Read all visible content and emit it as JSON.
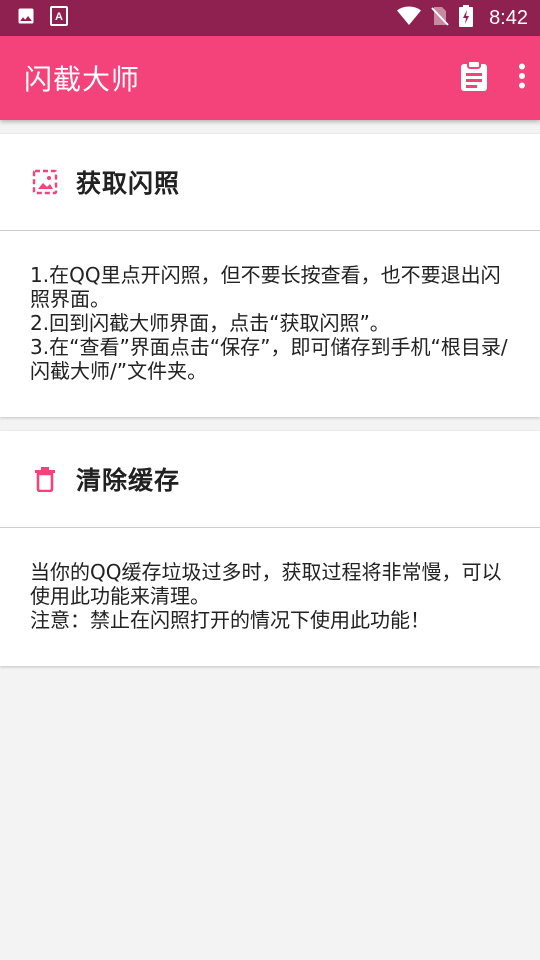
{
  "status_bar": {
    "time": "8:42",
    "left_icons": [
      "image-icon",
      "text-a-icon"
    ],
    "right_icons": [
      "wifi-icon",
      "no-sim-icon",
      "battery-charging-icon"
    ]
  },
  "app_bar": {
    "title": "闪截大师",
    "actions": [
      "clipboard-icon",
      "more-vert-icon"
    ],
    "color": "#f4437a",
    "status_color": "#8e2150"
  },
  "cards": [
    {
      "title": "获取闪照",
      "icon": "photo-icon",
      "lines": [
        "1.在QQ里点开闪照，但不要长按查看，也不要退出闪照界面。",
        "2.回到闪截大师界面，点击“获取闪照”。",
        "3.在“查看”界面点击“保存”，即可储存到手机“根目录/闪截大师/”文件夹。"
      ]
    },
    {
      "title": "清除缓存",
      "icon": "trash-icon",
      "lines": [
        "当你的QQ缓存垃圾过多时，获取过程将非常慢，可以使用此功能来清理。",
        "注意：禁止在闪照打开的情况下使用此功能！"
      ]
    }
  ]
}
